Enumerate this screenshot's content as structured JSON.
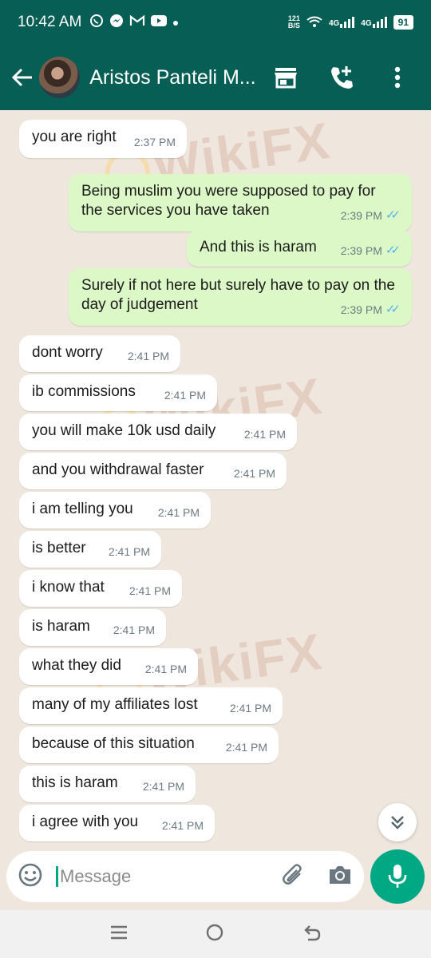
{
  "status_bar": {
    "time": "10:42 AM",
    "speed_value": "121",
    "speed_unit": "B/S",
    "network_1": "4G",
    "network_2": "4G",
    "battery": "91",
    "notif_icons": [
      "whatsapp-icon",
      "messenger-icon",
      "gmail-icon",
      "youtube-icon",
      "dot-icon"
    ]
  },
  "header": {
    "contact_name": "Aristos Panteli M...",
    "colors": {
      "header_bg": "#075e54",
      "bubble_out": "#dcf8c6",
      "bubble_in": "#ffffff",
      "chat_bg": "#efe7de",
      "mic_bg": "#00a884",
      "tick": "#4fb6ec"
    }
  },
  "watermark": "WikiFX",
  "messages": [
    {
      "direction": "in",
      "text": "you are right",
      "time": "2:37 PM"
    },
    {
      "direction": "out",
      "text": "Being muslim you were supposed to pay for the services you have taken",
      "time": "2:39 PM",
      "read": true
    },
    {
      "direction": "out",
      "text": "And this is haram",
      "time": "2:39 PM",
      "read": true
    },
    {
      "direction": "out",
      "text": "Surely if not here but surely have to pay on the day of judgement",
      "time": "2:39 PM",
      "read": true
    },
    {
      "direction": "in",
      "text": "dont worry",
      "time": "2:41 PM"
    },
    {
      "direction": "in",
      "text": "ib commissions",
      "time": "2:41 PM"
    },
    {
      "direction": "in",
      "text": "you will make 10k usd daily",
      "time": "2:41 PM"
    },
    {
      "direction": "in",
      "text": "and you withdrawal faster",
      "time": "2:41 PM"
    },
    {
      "direction": "in",
      "text": "i am telling you",
      "time": "2:41 PM"
    },
    {
      "direction": "in",
      "text": "is better",
      "time": "2:41 PM"
    },
    {
      "direction": "in",
      "text": "i know that",
      "time": "2:41 PM"
    },
    {
      "direction": "in",
      "text": "is haram",
      "time": "2:41 PM"
    },
    {
      "direction": "in",
      "text": "what they did",
      "time": "2:41 PM"
    },
    {
      "direction": "in",
      "text": "many of my affiliates lost",
      "time": "2:41 PM"
    },
    {
      "direction": "in",
      "text": "because of this situation",
      "time": "2:41 PM"
    },
    {
      "direction": "in",
      "text": "this is haram",
      "time": "2:41 PM"
    },
    {
      "direction": "in",
      "text": "i agree with you",
      "time": "2:41 PM"
    }
  ],
  "composer": {
    "placeholder": "Message"
  }
}
